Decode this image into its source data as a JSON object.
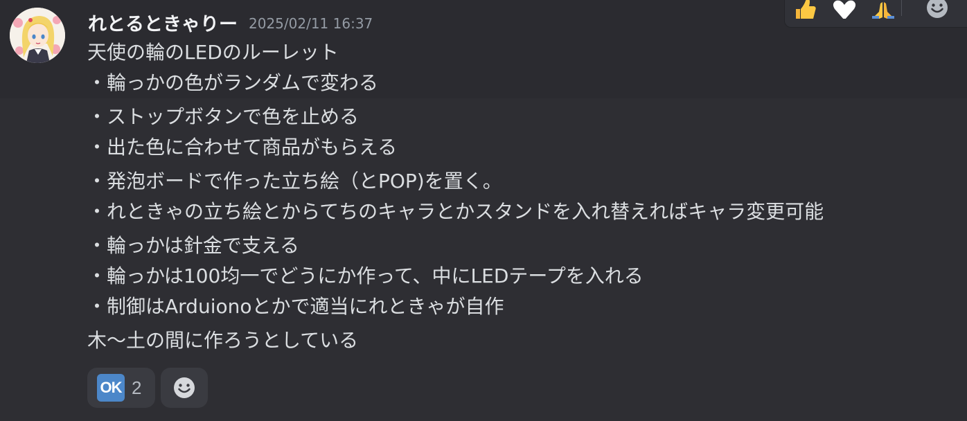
{
  "message": {
    "username": "れとるときゃりー",
    "timestamp": "2025/02/11 16:37",
    "lines": [
      "天使の輪のLEDのルーレット",
      "・輪っかの色がランダムで変わる",
      "・ストップボタンで色を止める",
      "・出た色に合わせて商品がもらえる",
      "・発泡ボードで作った立ち絵（とPOP)を置く。",
      "・れときゃの立ち絵とからてちのキャラとかスタンドを入れ替えればキャラ変更可能",
      "・輪っかは針金で支える",
      "・輪っかは100均一でどうにか作って、中にLEDテープを入れる",
      "・制御はArduionoとかで適当にれときゃが自作",
      "木〜土の間に作ろうとしている"
    ]
  },
  "reactions": [
    {
      "emoji": "ok-button-emoji",
      "label": "OK",
      "count": "2",
      "color": "#4c87c9"
    }
  ],
  "add_reaction": {
    "icon": "smiley-add-icon"
  },
  "toolbar": {
    "items": [
      {
        "icon": "thumbs-up-icon"
      },
      {
        "icon": "heart-icon"
      },
      {
        "icon": "folded-hands-icon"
      },
      {
        "icon": "add-reaction-icon"
      }
    ]
  }
}
